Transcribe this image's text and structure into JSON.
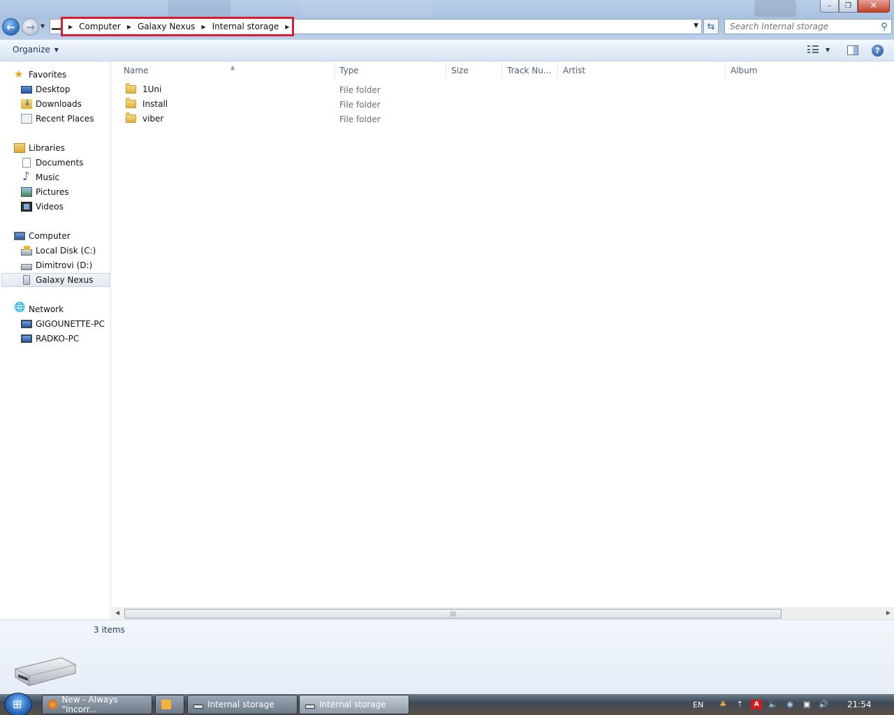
{
  "window": {
    "minimize_glyph": "–",
    "maximize_glyph": "❐",
    "close_glyph": "✕"
  },
  "address_bar": {
    "breadcrumbs": [
      "Computer",
      "Galaxy Nexus",
      "Internal storage"
    ],
    "highlight_color": "#e01a2e"
  },
  "search": {
    "placeholder": "Search Internal storage"
  },
  "toolbar": {
    "organize_label": "Organize"
  },
  "nav_pane": {
    "favorites": {
      "label": "Favorites",
      "items": [
        "Desktop",
        "Downloads",
        "Recent Places"
      ]
    },
    "libraries": {
      "label": "Libraries",
      "items": [
        "Documents",
        "Music",
        "Pictures",
        "Videos"
      ]
    },
    "computer": {
      "label": "Computer",
      "items": [
        "Local Disk (C:)",
        "Dimitrovi (D:)",
        "Galaxy Nexus"
      ]
    },
    "network": {
      "label": "Network",
      "items": [
        "GIGOUNETTE-PC",
        "RADKO-PC"
      ]
    }
  },
  "file_list": {
    "columns": [
      "Name",
      "Type",
      "Size",
      "Track Nu...",
      "Artist",
      "Album"
    ],
    "rows": [
      {
        "name": "1Uni",
        "type": "File folder"
      },
      {
        "name": "Install",
        "type": "File folder"
      },
      {
        "name": "viber",
        "type": "File folder"
      }
    ]
  },
  "status": {
    "item_count": "3 items"
  },
  "taskbar": {
    "tasks": [
      "New - Always \"Incorr...",
      "",
      "Internal storage",
      "Internal storage"
    ],
    "language": "EN",
    "clock": "21:54"
  }
}
